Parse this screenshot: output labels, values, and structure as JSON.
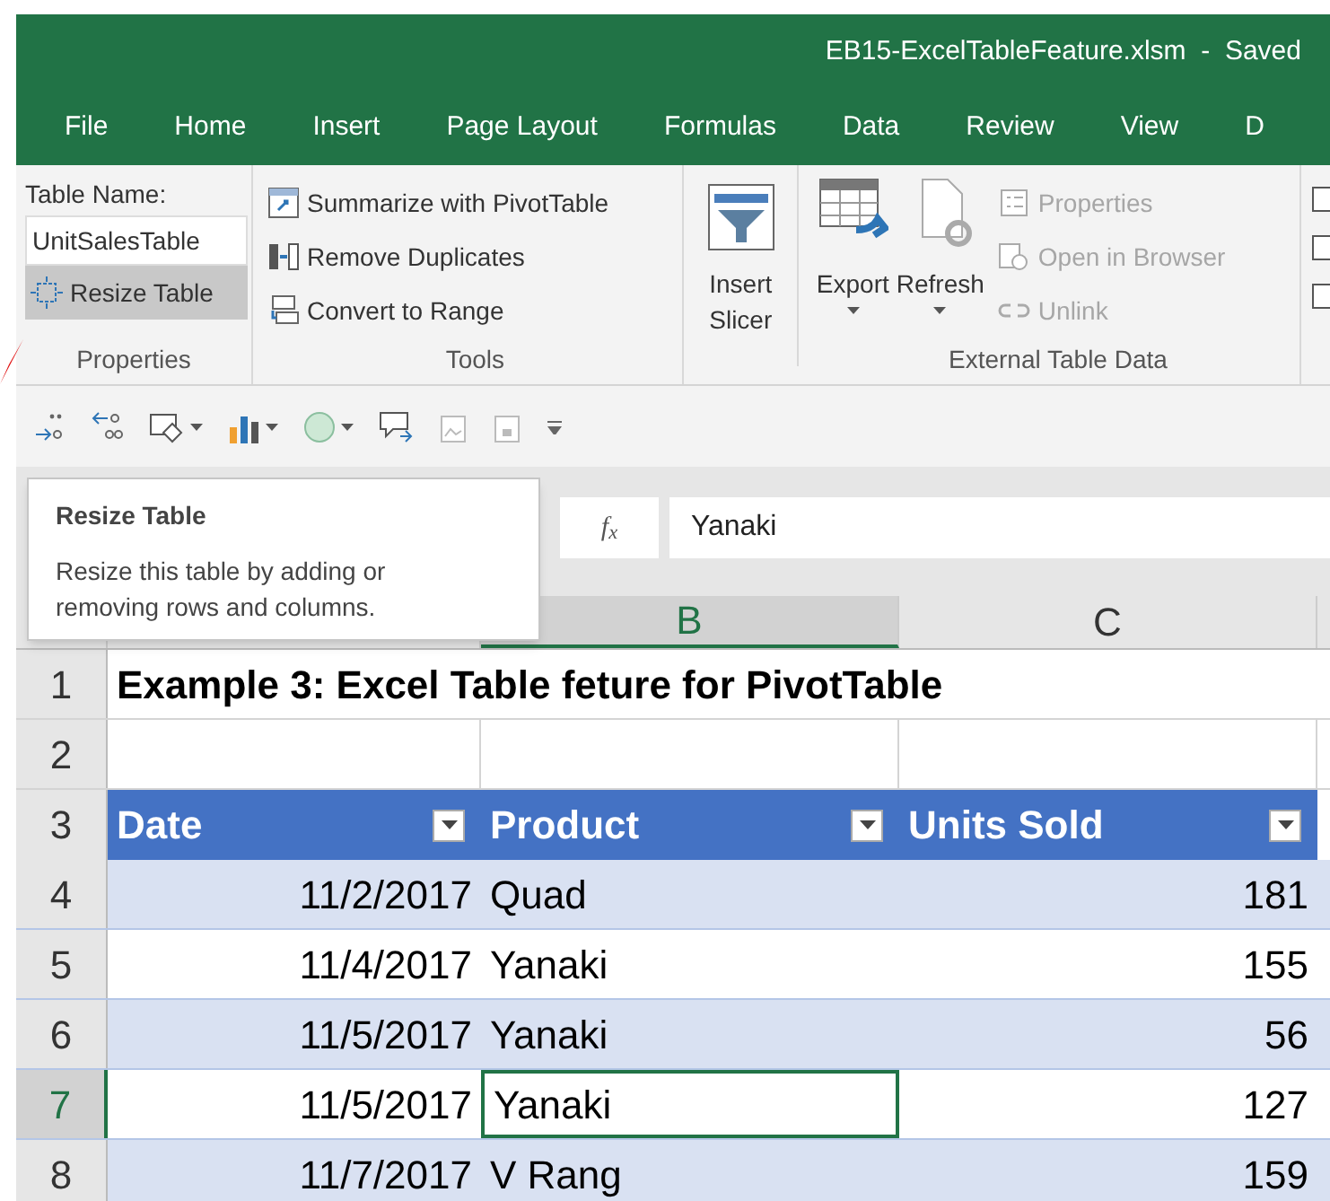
{
  "window": {
    "title": "EB15-ExcelTableFeature.xlsm  -  Saved"
  },
  "tabs": [
    {
      "label": "File"
    },
    {
      "label": "Home"
    },
    {
      "label": "Insert"
    },
    {
      "label": "Page Layout"
    },
    {
      "label": "Formulas"
    },
    {
      "label": "Data"
    },
    {
      "label": "Review"
    },
    {
      "label": "View"
    },
    {
      "label": "D"
    }
  ],
  "ribbon": {
    "properties": {
      "name_label": "Table Name:",
      "table_name": "UnitSalesTable",
      "resize": {
        "label": "Resize Table",
        "highlighted": true
      },
      "group": "Properties"
    },
    "tools": {
      "items": [
        {
          "label": "Summarize with PivotTable",
          "kind": "pivot"
        },
        {
          "label": "Remove Duplicates",
          "kind": "dupes"
        },
        {
          "label": "Convert to Range",
          "kind": "convert"
        }
      ],
      "group": "Tools"
    },
    "slicer": {
      "label": "Insert Slicer"
    },
    "external": {
      "export": "Export",
      "refresh": "Refresh",
      "items": [
        {
          "label": "Properties",
          "disabled": true,
          "kind": "props"
        },
        {
          "label": "Open in Browser",
          "disabled": true,
          "kind": "browser"
        },
        {
          "label": "Unlink",
          "disabled": true,
          "kind": "unlink"
        }
      ],
      "group": "External Table Data"
    }
  },
  "tooltip": {
    "title": "Resize Table",
    "text": "Resize this table by adding or removing rows and columns."
  },
  "formula_bar": {
    "fx": "f$_{x}$",
    "value": "Yanaki"
  },
  "columns": [
    {
      "label": "B",
      "selected": true
    },
    {
      "label": "C",
      "selected": false
    }
  ],
  "rows": [
    {
      "number": "1",
      "kind": "title",
      "text": "Example 3: Excel Table feture for PivotTable",
      "selected": false
    },
    {
      "number": "2",
      "kind": "blank",
      "selected": false
    },
    {
      "number": "3",
      "kind": "header",
      "cells": [
        "Date",
        "Product",
        "Units Sold"
      ],
      "selected": false
    },
    {
      "number": "4",
      "kind": "data",
      "cells": [
        "11/2/2017",
        "Quad",
        "181"
      ],
      "banded": true,
      "selected": false
    },
    {
      "number": "5",
      "kind": "data",
      "cells": [
        "11/4/2017",
        "Yanaki",
        "155"
      ],
      "banded": false,
      "selected": false
    },
    {
      "number": "6",
      "kind": "data",
      "cells": [
        "11/5/2017",
        "Yanaki",
        "56"
      ],
      "banded": true,
      "selected": false
    },
    {
      "number": "7",
      "kind": "data",
      "cells": [
        "11/5/2017",
        "Yanaki",
        "127"
      ],
      "banded": false,
      "selected": true
    },
    {
      "number": "8",
      "kind": "data",
      "cells": [
        "11/7/2017",
        "V Rang",
        "159"
      ],
      "banded": true,
      "selected": false
    }
  ]
}
